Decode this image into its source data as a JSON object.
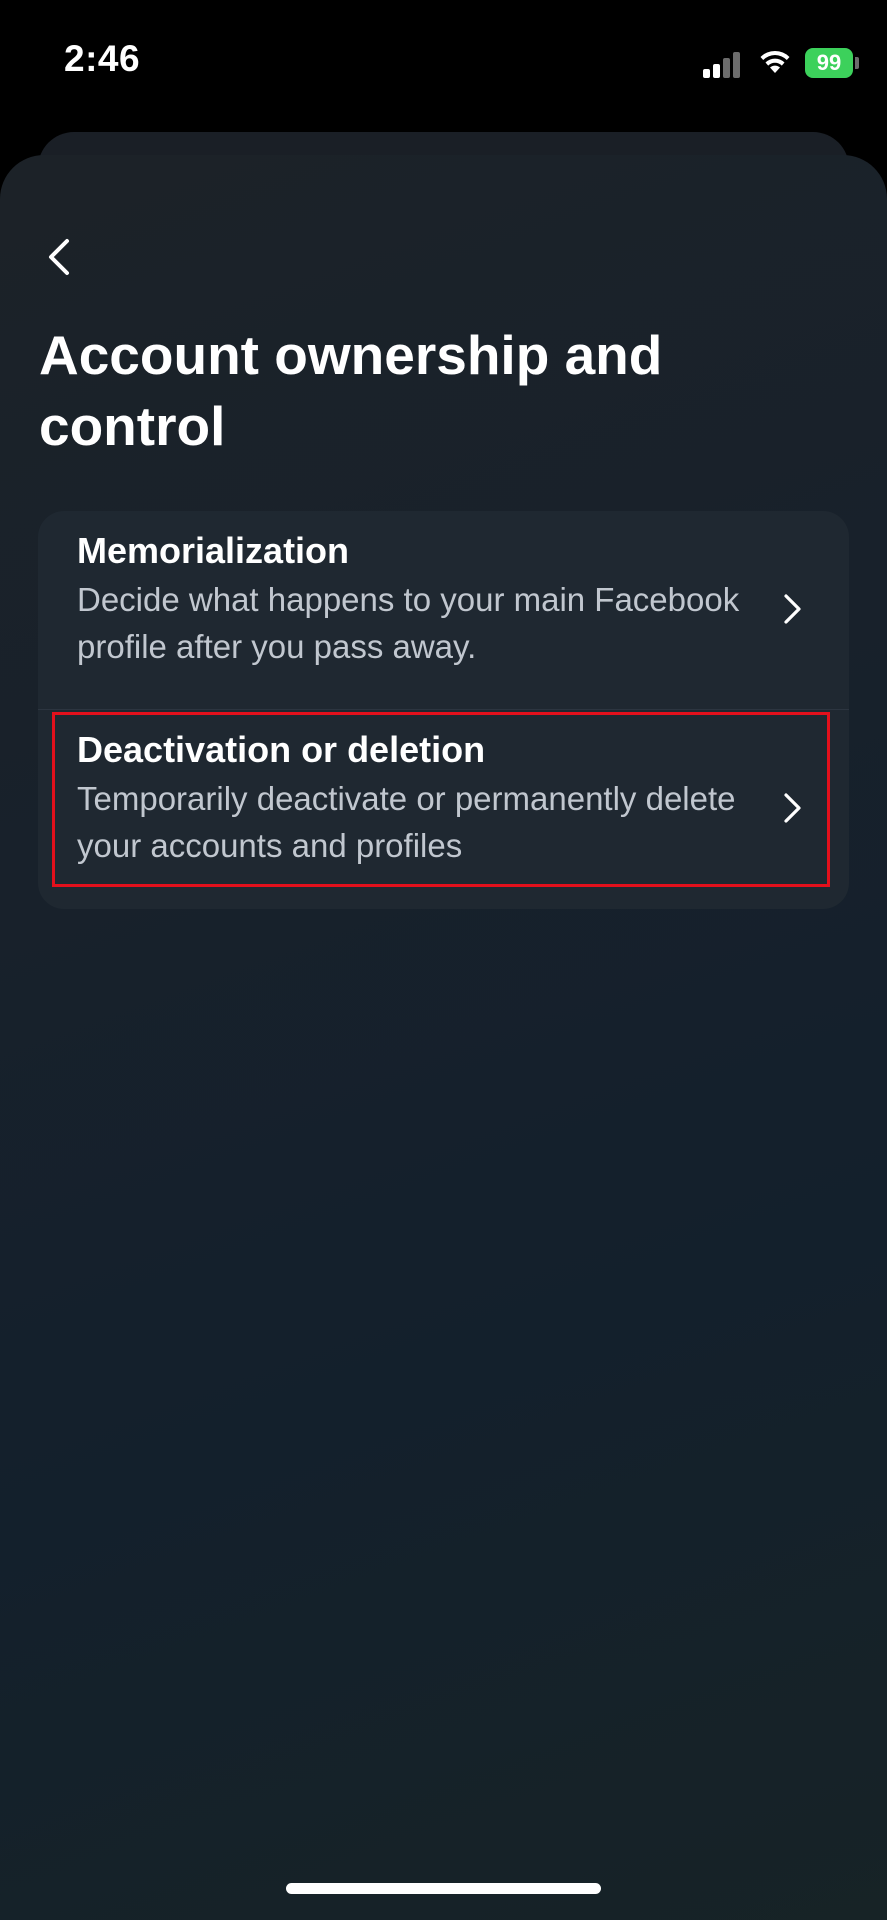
{
  "status_bar": {
    "time": "2:46",
    "battery": "99",
    "battery_color": "#3cd15b",
    "signal_icon": "cellular-signal-icon",
    "wifi_icon": "wifi-icon"
  },
  "header": {
    "back_icon": "chevron-left-icon",
    "title": "Account ownership and control"
  },
  "settings": {
    "items": [
      {
        "title": "Memorialization",
        "description": "Decide what happens to your main Facebook profile after you pass away.",
        "icon": "chevron-right-icon"
      },
      {
        "title": "Deactivation or deletion",
        "description": "Temporarily deactivate or permanently delete your accounts and profiles",
        "icon": "chevron-right-icon",
        "highlighted": true,
        "highlight_color": "#e3101c"
      }
    ]
  }
}
